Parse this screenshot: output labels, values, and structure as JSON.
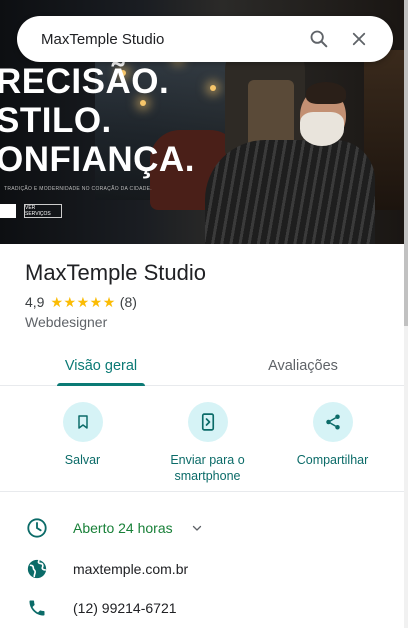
{
  "search": {
    "query": "MaxTemple Studio"
  },
  "hero": {
    "headline_lines": [
      "RECISÃO.",
      "STILO.",
      "ONFIANÇA."
    ],
    "tagline": "TRADIÇÃO E MODERNIDADE NO CORAÇÃO DA CIDADE.",
    "button2": "VER SERVIÇOS"
  },
  "place": {
    "title": "MaxTemple Studio",
    "rating": "4,9",
    "stars": 5,
    "review_count": "(8)",
    "category": "Webdesigner"
  },
  "tabs": [
    {
      "label": "Visão geral",
      "active": true
    },
    {
      "label": "Avaliações",
      "active": false
    }
  ],
  "actions": [
    {
      "label": "Salvar",
      "icon": "bookmark-icon"
    },
    {
      "label": "Enviar para o smartphone",
      "icon": "send-to-phone-icon"
    },
    {
      "label": "Compartilhar",
      "icon": "share-icon"
    }
  ],
  "details": {
    "hours": "Aberto 24 horas",
    "website": "maxtemple.com.br",
    "phone": "(12) 99214-6721"
  },
  "colors": {
    "accent": "#0b7a75",
    "star": "#fbbc04",
    "open": "#188038",
    "action_bg": "#d6f3f6"
  }
}
